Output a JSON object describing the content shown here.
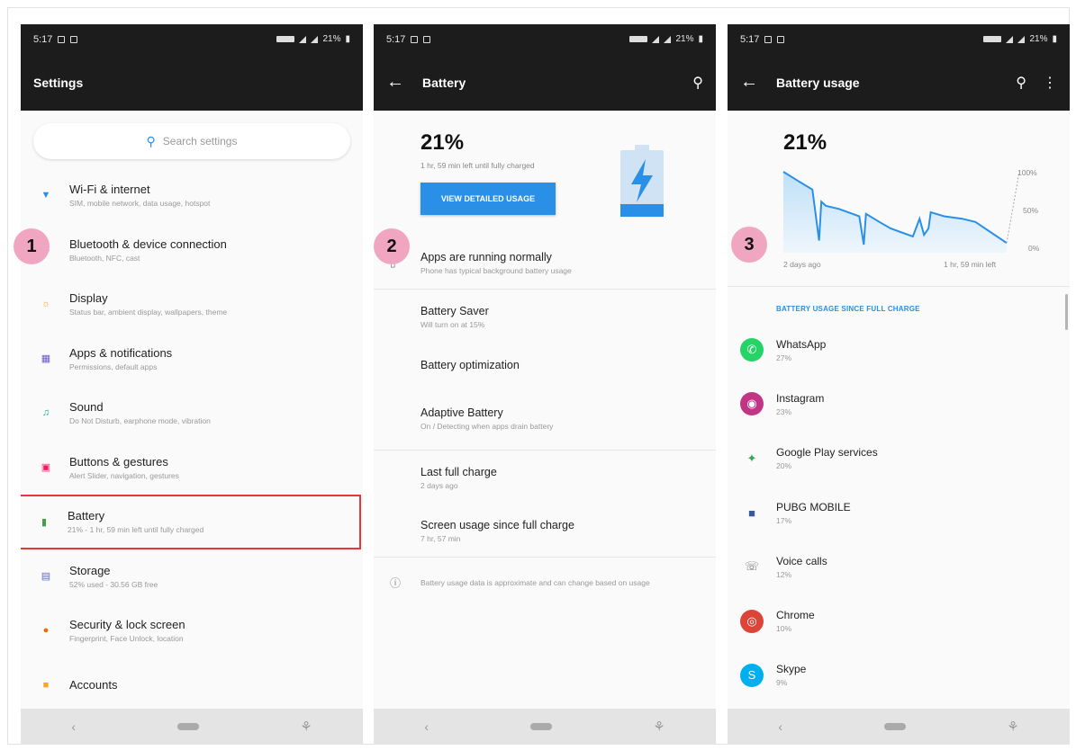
{
  "status_time": "5:17",
  "status_battery": "21%",
  "panel1": {
    "title": "Settings",
    "search_placeholder": "Search settings",
    "items": [
      {
        "title": "Wi-Fi & internet",
        "sub": "SIM, mobile network, data usage, hotspot",
        "icon": "wifi-icon",
        "color": "#2a8fe6"
      },
      {
        "title": "Bluetooth & device connection",
        "sub": "Bluetooth, NFC, cast",
        "icon": "bluetooth-icon",
        "color": "#2a8fe6"
      },
      {
        "title": "Display",
        "sub": "Status bar, ambient display, wallpapers, theme",
        "icon": "display-icon",
        "color": "#f5a623"
      },
      {
        "title": "Apps & notifications",
        "sub": "Permissions, default apps",
        "icon": "apps-icon",
        "color": "#6a5acd"
      },
      {
        "title": "Sound",
        "sub": "Do Not Disturb, earphone mode, vibration",
        "icon": "sound-icon",
        "color": "#26a69a"
      },
      {
        "title": "Buttons & gestures",
        "sub": "Alert Slider, navigation, gestures",
        "icon": "gestures-icon",
        "color": "#e91e63"
      },
      {
        "title": "Battery",
        "sub": "21% - 1 hr, 59 min left until fully charged",
        "icon": "battery-icon",
        "color": "#43a047"
      },
      {
        "title": "Storage",
        "sub": "52% used - 30.56 GB free",
        "icon": "storage-icon",
        "color": "#5c6bc0"
      },
      {
        "title": "Security & lock screen",
        "sub": "Fingerprint, Face Unlock, location",
        "icon": "lock-icon",
        "color": "#ef6c00"
      },
      {
        "title": "Accounts",
        "sub": "",
        "icon": "accounts-icon",
        "color": "#f5a623"
      }
    ],
    "step": "1"
  },
  "panel2": {
    "title": "Battery",
    "percent": "21%",
    "time_left": "1 hr, 59 min left until fully charged",
    "button": "VIEW DETAILED USAGE",
    "rows": [
      {
        "title": "Apps are running normally",
        "sub": "Phone has typical background battery usage"
      },
      {
        "title": "Battery Saver",
        "sub": "Will turn on at 15%"
      },
      {
        "title": "Battery optimization",
        "sub": ""
      },
      {
        "title": "Adaptive Battery",
        "sub": "On / Detecting when apps drain battery"
      },
      {
        "title": "Last full charge",
        "sub": "2 days ago"
      },
      {
        "title": "Screen usage since full charge",
        "sub": "7 hr, 57 min"
      }
    ],
    "footnote": "Battery usage data is approximate and can change based on usage",
    "step": "2"
  },
  "panel3": {
    "title": "Battery usage",
    "percent": "21%",
    "y_labels": [
      "100%",
      "50%",
      "0%"
    ],
    "x_start": "2 days ago",
    "x_end": "1 hr, 59 min left",
    "section": "BATTERY USAGE SINCE FULL CHARGE",
    "apps": [
      {
        "name": "WhatsApp",
        "pct": "27%",
        "icon": "whatsapp-icon",
        "color": "#25d366"
      },
      {
        "name": "Instagram",
        "pct": "23%",
        "icon": "instagram-icon",
        "color": "#c13584"
      },
      {
        "name": "Google Play services",
        "pct": "20%",
        "icon": "google-play-services-icon",
        "color": "#34a853"
      },
      {
        "name": "PUBG MOBILE",
        "pct": "17%",
        "icon": "pubg-icon",
        "color": "#3b5998"
      },
      {
        "name": "Voice calls",
        "pct": "12%",
        "icon": "phone-icon",
        "color": "#777777"
      },
      {
        "name": "Chrome",
        "pct": "10%",
        "icon": "chrome-icon",
        "color": "#db4437"
      },
      {
        "name": "Skype",
        "pct": "9%",
        "icon": "skype-icon",
        "color": "#00aff0"
      }
    ],
    "step": "3"
  },
  "chart_data": {
    "type": "line",
    "x": [
      0,
      0.07,
      0.13,
      0.16,
      0.17,
      0.19,
      0.25,
      0.34,
      0.36,
      0.37,
      0.43,
      0.48,
      0.53,
      0.58,
      0.61,
      0.63,
      0.65,
      0.66,
      0.72,
      0.8,
      0.86,
      0.93,
      1.0
    ],
    "values": [
      100,
      88,
      78,
      15,
      63,
      58,
      54,
      45,
      10,
      48,
      38,
      30,
      25,
      20,
      42,
      22,
      30,
      50,
      45,
      42,
      38,
      25,
      12
    ],
    "ylim": [
      0,
      100
    ],
    "y_tick_labels": [
      "100%",
      "50%",
      "0%"
    ],
    "x_tick_labels": [
      "2 days ago",
      "1 hr, 59 min left"
    ]
  }
}
